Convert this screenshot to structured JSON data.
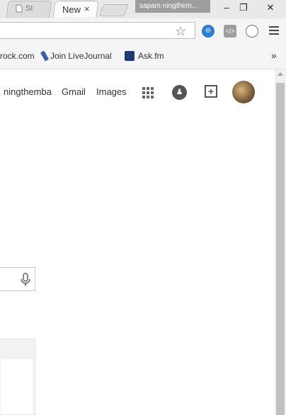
{
  "tabs": [
    {
      "label": "St",
      "active": false
    },
    {
      "label": "New",
      "active": true,
      "close": "×"
    }
  ],
  "profile": {
    "name": "sapam ningthem..."
  },
  "window_controls": {
    "minimize": "–",
    "restore": "❐",
    "close": "✕"
  },
  "toolbar": {
    "star": "☆",
    "ext1": "⊜",
    "ext2": "</>"
  },
  "bookmarks": [
    {
      "label": "rock.com",
      "icon_color": ""
    },
    {
      "label": "Join LiveJournal",
      "icon_color": "#3a5fa8"
    },
    {
      "label": "Ask.fm",
      "icon_color": "#1f3c6e"
    }
  ],
  "bookmarks_overflow": "»",
  "google_bar": {
    "user_link": "ningthemba",
    "gmail": "Gmail",
    "images": "Images",
    "bell": "♟",
    "share": "+"
  },
  "colors": {
    "accent": "#2e7bd1",
    "profile_badge": "#9d9d9d"
  }
}
